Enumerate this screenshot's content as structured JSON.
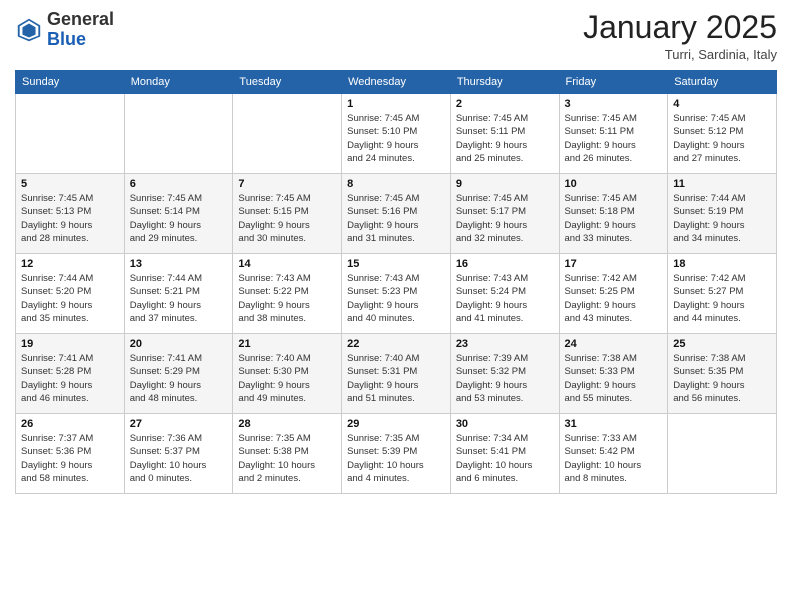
{
  "logo": {
    "general": "General",
    "blue": "Blue"
  },
  "header": {
    "month": "January 2025",
    "location": "Turri, Sardinia, Italy"
  },
  "weekdays": [
    "Sunday",
    "Monday",
    "Tuesday",
    "Wednesday",
    "Thursday",
    "Friday",
    "Saturday"
  ],
  "weeks": [
    [
      {
        "day": "",
        "info": ""
      },
      {
        "day": "",
        "info": ""
      },
      {
        "day": "",
        "info": ""
      },
      {
        "day": "1",
        "info": "Sunrise: 7:45 AM\nSunset: 5:10 PM\nDaylight: 9 hours\nand 24 minutes."
      },
      {
        "day": "2",
        "info": "Sunrise: 7:45 AM\nSunset: 5:11 PM\nDaylight: 9 hours\nand 25 minutes."
      },
      {
        "day": "3",
        "info": "Sunrise: 7:45 AM\nSunset: 5:11 PM\nDaylight: 9 hours\nand 26 minutes."
      },
      {
        "day": "4",
        "info": "Sunrise: 7:45 AM\nSunset: 5:12 PM\nDaylight: 9 hours\nand 27 minutes."
      }
    ],
    [
      {
        "day": "5",
        "info": "Sunrise: 7:45 AM\nSunset: 5:13 PM\nDaylight: 9 hours\nand 28 minutes."
      },
      {
        "day": "6",
        "info": "Sunrise: 7:45 AM\nSunset: 5:14 PM\nDaylight: 9 hours\nand 29 minutes."
      },
      {
        "day": "7",
        "info": "Sunrise: 7:45 AM\nSunset: 5:15 PM\nDaylight: 9 hours\nand 30 minutes."
      },
      {
        "day": "8",
        "info": "Sunrise: 7:45 AM\nSunset: 5:16 PM\nDaylight: 9 hours\nand 31 minutes."
      },
      {
        "day": "9",
        "info": "Sunrise: 7:45 AM\nSunset: 5:17 PM\nDaylight: 9 hours\nand 32 minutes."
      },
      {
        "day": "10",
        "info": "Sunrise: 7:45 AM\nSunset: 5:18 PM\nDaylight: 9 hours\nand 33 minutes."
      },
      {
        "day": "11",
        "info": "Sunrise: 7:44 AM\nSunset: 5:19 PM\nDaylight: 9 hours\nand 34 minutes."
      }
    ],
    [
      {
        "day": "12",
        "info": "Sunrise: 7:44 AM\nSunset: 5:20 PM\nDaylight: 9 hours\nand 35 minutes."
      },
      {
        "day": "13",
        "info": "Sunrise: 7:44 AM\nSunset: 5:21 PM\nDaylight: 9 hours\nand 37 minutes."
      },
      {
        "day": "14",
        "info": "Sunrise: 7:43 AM\nSunset: 5:22 PM\nDaylight: 9 hours\nand 38 minutes."
      },
      {
        "day": "15",
        "info": "Sunrise: 7:43 AM\nSunset: 5:23 PM\nDaylight: 9 hours\nand 40 minutes."
      },
      {
        "day": "16",
        "info": "Sunrise: 7:43 AM\nSunset: 5:24 PM\nDaylight: 9 hours\nand 41 minutes."
      },
      {
        "day": "17",
        "info": "Sunrise: 7:42 AM\nSunset: 5:25 PM\nDaylight: 9 hours\nand 43 minutes."
      },
      {
        "day": "18",
        "info": "Sunrise: 7:42 AM\nSunset: 5:27 PM\nDaylight: 9 hours\nand 44 minutes."
      }
    ],
    [
      {
        "day": "19",
        "info": "Sunrise: 7:41 AM\nSunset: 5:28 PM\nDaylight: 9 hours\nand 46 minutes."
      },
      {
        "day": "20",
        "info": "Sunrise: 7:41 AM\nSunset: 5:29 PM\nDaylight: 9 hours\nand 48 minutes."
      },
      {
        "day": "21",
        "info": "Sunrise: 7:40 AM\nSunset: 5:30 PM\nDaylight: 9 hours\nand 49 minutes."
      },
      {
        "day": "22",
        "info": "Sunrise: 7:40 AM\nSunset: 5:31 PM\nDaylight: 9 hours\nand 51 minutes."
      },
      {
        "day": "23",
        "info": "Sunrise: 7:39 AM\nSunset: 5:32 PM\nDaylight: 9 hours\nand 53 minutes."
      },
      {
        "day": "24",
        "info": "Sunrise: 7:38 AM\nSunset: 5:33 PM\nDaylight: 9 hours\nand 55 minutes."
      },
      {
        "day": "25",
        "info": "Sunrise: 7:38 AM\nSunset: 5:35 PM\nDaylight: 9 hours\nand 56 minutes."
      }
    ],
    [
      {
        "day": "26",
        "info": "Sunrise: 7:37 AM\nSunset: 5:36 PM\nDaylight: 9 hours\nand 58 minutes."
      },
      {
        "day": "27",
        "info": "Sunrise: 7:36 AM\nSunset: 5:37 PM\nDaylight: 10 hours\nand 0 minutes."
      },
      {
        "day": "28",
        "info": "Sunrise: 7:35 AM\nSunset: 5:38 PM\nDaylight: 10 hours\nand 2 minutes."
      },
      {
        "day": "29",
        "info": "Sunrise: 7:35 AM\nSunset: 5:39 PM\nDaylight: 10 hours\nand 4 minutes."
      },
      {
        "day": "30",
        "info": "Sunrise: 7:34 AM\nSunset: 5:41 PM\nDaylight: 10 hours\nand 6 minutes."
      },
      {
        "day": "31",
        "info": "Sunrise: 7:33 AM\nSunset: 5:42 PM\nDaylight: 10 hours\nand 8 minutes."
      },
      {
        "day": "",
        "info": ""
      }
    ]
  ]
}
